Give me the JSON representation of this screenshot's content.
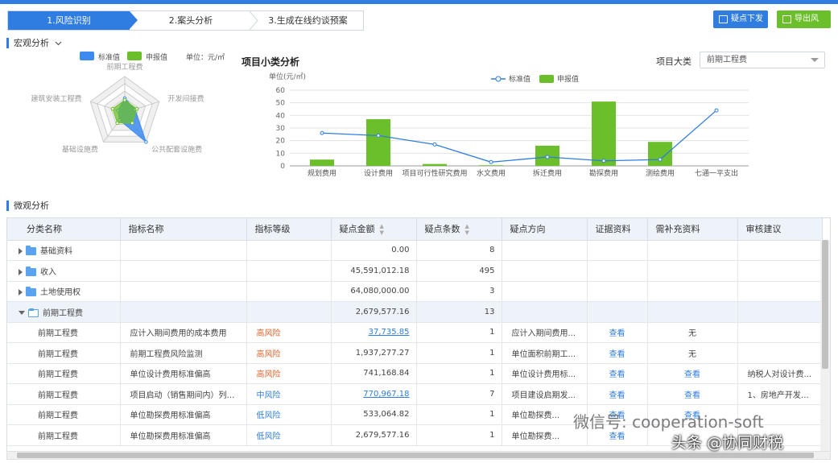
{
  "steps": [
    "1.风险识别",
    "2.案头分析",
    "3.生成在线约谈预案"
  ],
  "buttons": {
    "doubt": "疑点下发",
    "export": "导出风险"
  },
  "macro": {
    "title": "宏观分析",
    "legend_standard": "标准值",
    "legend_declared": "申报值",
    "unit": "单位：元/㎡"
  },
  "radar": {
    "axes": [
      "前期工程费",
      "开发间接费",
      "公共配套设施费",
      "基础设施费",
      "建筑安装工程费"
    ],
    "standard": [
      0.35,
      0.35,
      0.35,
      0.35,
      0.35
    ],
    "declared": [
      0.4,
      0.3,
      1.0,
      0.25,
      0.2
    ],
    "colors": {
      "standard": "#3d8bf0",
      "declared": "#6bbf2a"
    }
  },
  "chart_data": {
    "type": "bar",
    "title": "项目小类分析",
    "ylabel": "单位(元/㎡)",
    "ylim": [
      0,
      60
    ],
    "yticks": [
      0,
      10,
      20,
      30,
      40,
      50,
      60
    ],
    "categories": [
      "规划费用",
      "设计费用",
      "项目可行性研究费用",
      "水文费用",
      "拆迁费用",
      "勘探费用",
      "测绘费用",
      "七通一平支出"
    ],
    "series": [
      {
        "name": "标准值",
        "type": "line",
        "color": "#2f7de1",
        "values": [
          26,
          24,
          17,
          3,
          7,
          4,
          5,
          44
        ]
      },
      {
        "name": "申报值",
        "type": "bar",
        "color": "#6bbf2a",
        "values": [
          5,
          37,
          1.5,
          0.5,
          16,
          51,
          19,
          0
        ]
      }
    ],
    "grid": true,
    "legend": "top-center"
  },
  "category_select": {
    "label": "项目大类",
    "value": "前期工程费"
  },
  "micro": {
    "title": "微观分析"
  },
  "table": {
    "headers": [
      "分类名称",
      "指标名称",
      "指标等级",
      "疑点金额",
      "疑点条数",
      "疑点方向",
      "证据资料",
      "需补充资料",
      "审核建议"
    ],
    "groups": [
      {
        "name": "基础资料",
        "amount": "0.00",
        "count": "8",
        "open": false
      },
      {
        "name": "收入",
        "amount": "45,591,012.18",
        "count": "495",
        "open": false
      },
      {
        "name": "土地使用权",
        "amount": "64,080,000.00",
        "count": "3",
        "open": false
      },
      {
        "name": "前期工程费",
        "amount": "2,679,577.16",
        "count": "13",
        "open": true
      }
    ],
    "rows": [
      {
        "cat": "前期工程费",
        "name": "应计入期间费用的成本费用",
        "level": "高风险",
        "level_type": "high",
        "amount": "37,735.85",
        "amount_link": true,
        "count": "1",
        "direction": "应计入期间费用...",
        "evidence": "查看",
        "supplement": "无",
        "advice": ""
      },
      {
        "cat": "前期工程费",
        "name": "前期工程费风险监测",
        "level": "高风险",
        "level_type": "high",
        "amount": "1,937,277.27",
        "amount_link": false,
        "count": "1",
        "direction": "单位面积前期工...",
        "evidence": "查看",
        "supplement": "无",
        "advice": ""
      },
      {
        "cat": "前期工程费",
        "name": "单位设计费用标准偏高",
        "level": "高风险",
        "level_type": "high",
        "amount": "741,168.84",
        "amount_link": false,
        "count": "1",
        "direction": "单位设计费用标...",
        "evidence": "查看",
        "supplement": "查看",
        "advice": "纳税人对设计费..."
      },
      {
        "cat": "前期工程费",
        "name": "项目启动（销售期间内）列支...",
        "level": "中风险",
        "level_type": "mid",
        "amount": "770,967.18",
        "amount_link": true,
        "count": "7",
        "direction": "项目建设启期发...",
        "evidence": "查看",
        "supplement": "查看",
        "advice": "1、房地产开发费..."
      },
      {
        "cat": "前期工程费",
        "name": "单位勘探费用标准偏高",
        "level": "低风险",
        "level_type": "low",
        "amount": "533,064.82",
        "amount_link": false,
        "count": "1",
        "direction": "单位勘探费...",
        "evidence": "查看",
        "supplement": "查看",
        "advice": ""
      },
      {
        "cat": "前期工程费",
        "name": "单位勘探费用标准偏高",
        "level": "低风险",
        "level_type": "low",
        "amount": "2,679,577.16",
        "amount_link": false,
        "count": "1",
        "direction": "单位勘探费...",
        "evidence": "查看",
        "supplement": "",
        "advice": ""
      }
    ]
  },
  "watermark": {
    "line1": "微信号: cooperation-soft",
    "line2": "头条 @协同财税"
  }
}
